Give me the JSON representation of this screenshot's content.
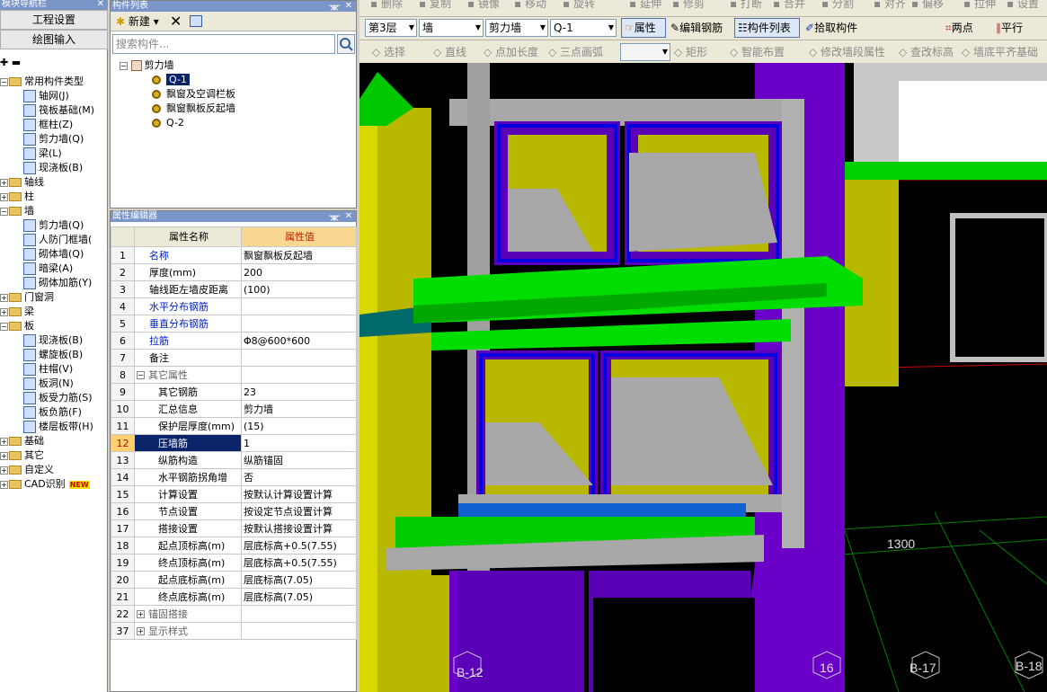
{
  "nav": {
    "title": "模块导航栏",
    "btn_settings": "工程设置",
    "btn_draw": "绘图输入",
    "tree": [
      {
        "label": "常用构件类型",
        "type": "folder",
        "sign": "-",
        "level": 0
      },
      {
        "label": "轴网(J)",
        "type": "item",
        "level": 1
      },
      {
        "label": "筏板基础(M)",
        "type": "item",
        "level": 1
      },
      {
        "label": "框柱(Z)",
        "type": "item",
        "level": 1
      },
      {
        "label": "剪力墙(Q)",
        "type": "item",
        "level": 1
      },
      {
        "label": "梁(L)",
        "type": "item",
        "level": 1
      },
      {
        "label": "现浇板(B)",
        "type": "item",
        "level": 1
      },
      {
        "label": "轴线",
        "type": "folder",
        "sign": "+",
        "level": 0
      },
      {
        "label": "柱",
        "type": "folder",
        "sign": "+",
        "level": 0
      },
      {
        "label": "墙",
        "type": "folder",
        "sign": "-",
        "level": 0
      },
      {
        "label": "剪力墙(Q)",
        "type": "item",
        "level": 1
      },
      {
        "label": "人防门框墙(",
        "type": "item",
        "level": 1
      },
      {
        "label": "砌体墙(Q)",
        "type": "item",
        "level": 1
      },
      {
        "label": "暗梁(A)",
        "type": "item",
        "level": 1
      },
      {
        "label": "砌体加筋(Y)",
        "type": "item",
        "level": 1
      },
      {
        "label": "门窗洞",
        "type": "folder",
        "sign": "+",
        "level": 0
      },
      {
        "label": "梁",
        "type": "folder",
        "sign": "+",
        "level": 0
      },
      {
        "label": "板",
        "type": "folder",
        "sign": "-",
        "level": 0
      },
      {
        "label": "现浇板(B)",
        "type": "item",
        "level": 1
      },
      {
        "label": "螺旋板(B)",
        "type": "item",
        "level": 1
      },
      {
        "label": "柱帽(V)",
        "type": "item",
        "level": 1
      },
      {
        "label": "板洞(N)",
        "type": "item",
        "level": 1
      },
      {
        "label": "板受力筋(S)",
        "type": "item",
        "level": 1
      },
      {
        "label": "板负筋(F)",
        "type": "item",
        "level": 1
      },
      {
        "label": "楼层板带(H)",
        "type": "item",
        "level": 1
      },
      {
        "label": "基础",
        "type": "folder",
        "sign": "+",
        "level": 0
      },
      {
        "label": "其它",
        "type": "folder",
        "sign": "+",
        "level": 0
      },
      {
        "label": "自定义",
        "type": "folder",
        "sign": "+",
        "level": 0
      },
      {
        "label": "CAD识别",
        "type": "folder",
        "sign": "+",
        "level": 0,
        "badge": "NEW"
      }
    ]
  },
  "component_list": {
    "title": "构件列表",
    "new_label": "新建",
    "search_placeholder": "搜索构件...",
    "root": "剪力墙",
    "items": [
      "Q-1",
      "飘窗及空调栏板",
      "飘窗飘板反起墙",
      "Q-2"
    ],
    "selected": "Q-1"
  },
  "property_editor": {
    "title": "属性编辑器",
    "col_name": "属性名称",
    "col_value": "属性值",
    "rows": [
      {
        "n": "1",
        "name": "名称",
        "value": "飘窗飘板反起墙",
        "style": "blue"
      },
      {
        "n": "2",
        "name": "厚度(mm)",
        "value": "200"
      },
      {
        "n": "3",
        "name": "轴线距左墙皮距离",
        "value": "(100)"
      },
      {
        "n": "4",
        "name": "水平分布钢筋",
        "value": "",
        "style": "blue"
      },
      {
        "n": "5",
        "name": "垂直分布钢筋",
        "value": "",
        "style": "blue"
      },
      {
        "n": "6",
        "name": "拉筋",
        "value": "Φ8@600*600",
        "style": "blue"
      },
      {
        "n": "7",
        "name": "备注",
        "value": ""
      },
      {
        "n": "8",
        "name": "其它属性",
        "value": "",
        "group": "-",
        "style": "gray"
      },
      {
        "n": "9",
        "name": "其它钢筋",
        "value": "23",
        "child": true
      },
      {
        "n": "10",
        "name": "汇总信息",
        "value": "剪力墙",
        "child": true
      },
      {
        "n": "11",
        "name": "保护层厚度(mm)",
        "value": "(15)",
        "child": true
      },
      {
        "n": "12",
        "name": "压墙筋",
        "value": "1",
        "child": true,
        "selected": true
      },
      {
        "n": "13",
        "name": "纵筋构造",
        "value": "纵筋锚固",
        "child": true
      },
      {
        "n": "14",
        "name": "水平钢筋拐角增",
        "value": "否",
        "child": true
      },
      {
        "n": "15",
        "name": "计算设置",
        "value": "按默认计算设置计算",
        "child": true
      },
      {
        "n": "16",
        "name": "节点设置",
        "value": "按设定节点设置计算",
        "child": true
      },
      {
        "n": "17",
        "name": "搭接设置",
        "value": "按默认搭接设置计算",
        "child": true
      },
      {
        "n": "18",
        "name": "起点顶标高(m)",
        "value": "层底标高+0.5(7.55)",
        "child": true
      },
      {
        "n": "19",
        "name": "终点顶标高(m)",
        "value": "层底标高+0.5(7.55)",
        "child": true
      },
      {
        "n": "20",
        "name": "起点底标高(m)",
        "value": "层底标高(7.05)",
        "child": true
      },
      {
        "n": "21",
        "name": "终点底标高(m)",
        "value": "层底标高(7.05)",
        "child": true
      },
      {
        "n": "22",
        "name": "锚固搭接",
        "value": "",
        "group": "+",
        "style": "gray"
      },
      {
        "n": "37",
        "name": "显示样式",
        "value": "",
        "group": "+",
        "style": "gray"
      }
    ]
  },
  "toolbar": {
    "row1": [
      "删除",
      "复制",
      "镜像",
      "移动",
      "旋转",
      "延伸",
      "修剪",
      "打断",
      "合并",
      "分割",
      "对齐",
      "偏移",
      "拉伸",
      "设置"
    ],
    "floor": "第3层",
    "category": "墙",
    "type": "剪力墙",
    "component": "Q-1",
    "btn_props": "属性",
    "btn_edit_rebar": "编辑钢筋",
    "btn_list": "构件列表",
    "btn_pick": "拾取构件",
    "btn_two_point": "两点",
    "btn_parallel": "平行",
    "row3": [
      "选择",
      "直线",
      "点加长度",
      "三点画弧",
      "矩形",
      "智能布置",
      "修改墙段属性",
      "查改标高",
      "墙底平齐基础"
    ]
  },
  "viewport": {
    "dimension": "1300",
    "axis_labels": [
      "B-12",
      "16",
      "B-17",
      "B-18"
    ],
    "colors": {
      "green": "#00d800",
      "purple": "#6a00c8",
      "yellow": "#b8b800",
      "gray": "#b0b0b0",
      "teal": "#006a6a",
      "blue": "#0000e0"
    }
  }
}
